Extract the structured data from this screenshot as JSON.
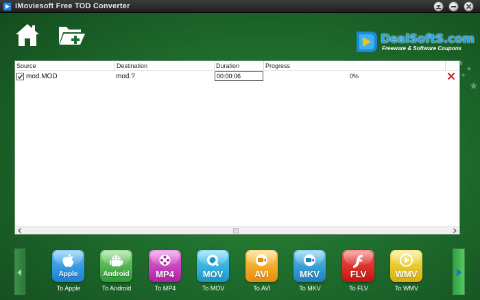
{
  "window": {
    "title": "iMoviesoft Free TOD Converter"
  },
  "logo": {
    "name": "DealSoftS.com",
    "tagline": "Freeware & Software Coupons"
  },
  "file_list": {
    "columns": [
      "Source",
      "Destination",
      "Duration",
      "Progress"
    ],
    "rows": [
      {
        "checked": true,
        "source": "mod.MOD",
        "destination": "mod.?",
        "duration": "00:00:06",
        "progress": "0%"
      }
    ]
  },
  "formats": [
    {
      "tile_label": "Apple",
      "caption": "To Apple",
      "color": "#1a8fe0",
      "icon": "apple-icon"
    },
    {
      "tile_label": "Android",
      "caption": "To Android",
      "color": "#3aa640",
      "icon": "android-icon"
    },
    {
      "tile_label": "MP4",
      "caption": "To MP4",
      "color": "#c52fb8",
      "icon": "film-reel-icon"
    },
    {
      "tile_label": "MOV",
      "caption": "To MOV",
      "color": "#22a7d6",
      "icon": "quicktime-icon"
    },
    {
      "tile_label": "AVI",
      "caption": "To AVI",
      "color": "#f2a21b",
      "icon": "camera-icon"
    },
    {
      "tile_label": "MKV",
      "caption": "To MKV",
      "color": "#2196c9",
      "icon": "camera-icon"
    },
    {
      "tile_label": "FLV",
      "caption": "To FLV",
      "color": "#d6221f",
      "icon": "flash-icon"
    },
    {
      "tile_label": "WMV",
      "caption": "To WMV",
      "color": "#e6c51b",
      "icon": "play-icon"
    }
  ]
}
